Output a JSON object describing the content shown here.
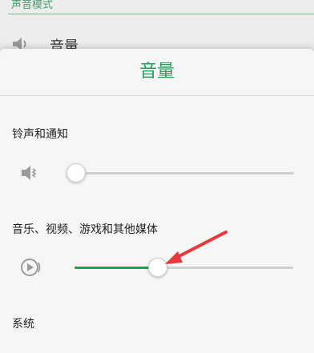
{
  "background": {
    "section_title": "声音模式",
    "volume_row_label": "音量",
    "volume_icon": "speaker-icon"
  },
  "dialog": {
    "title": "音量",
    "ringtone": {
      "label": "铃声和通知",
      "icon": "speaker-icon",
      "level": 0.0
    },
    "media": {
      "label": "音乐、视频、游戏和其他媒体",
      "icon": "play-circle-icon",
      "level": 0.38
    },
    "system": {
      "label": "系统"
    }
  },
  "colors": {
    "accent": "#16a54d",
    "title_green": "#1e9f5a",
    "arrow": "#e8383a"
  }
}
